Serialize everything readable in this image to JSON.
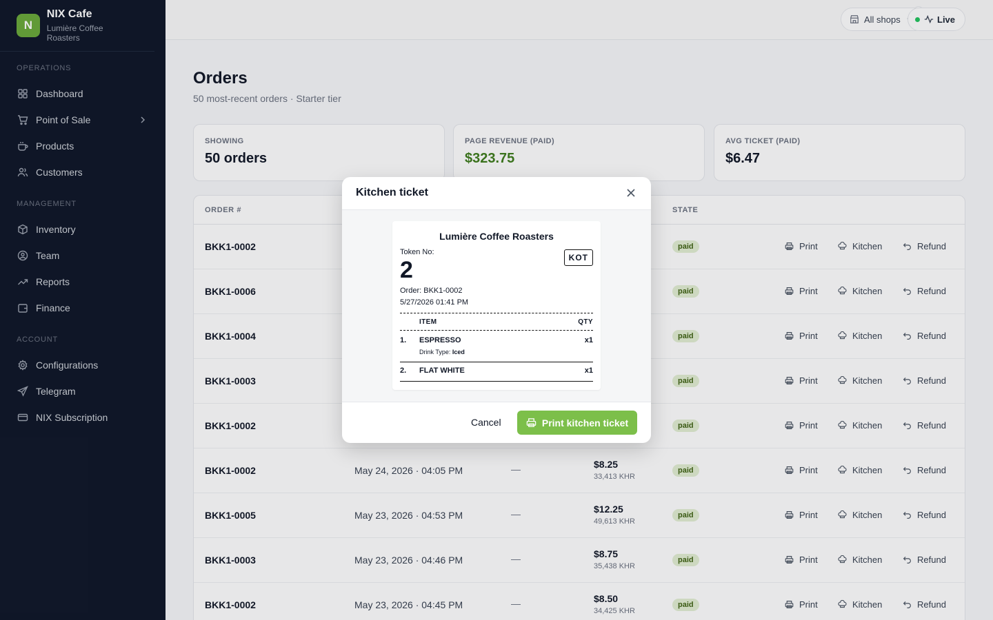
{
  "brand": {
    "initial": "N",
    "name": "NIX Cafe",
    "sub": "Lumière Coffee Roasters"
  },
  "sidebar": {
    "sections": [
      {
        "label": "OPERATIONS",
        "items": [
          {
            "label": "Dashboard",
            "icon": "grid-icon"
          },
          {
            "label": "Point of Sale",
            "icon": "cart-icon"
          },
          {
            "label": "Products",
            "icon": "cup-icon"
          },
          {
            "label": "Customers",
            "icon": "users-icon"
          }
        ]
      },
      {
        "label": "MANAGEMENT",
        "items": [
          {
            "label": "Inventory",
            "icon": "box-icon"
          },
          {
            "label": "Team",
            "icon": "user-circle-icon"
          },
          {
            "label": "Reports",
            "icon": "trend-icon"
          },
          {
            "label": "Finance",
            "icon": "wallet-icon"
          }
        ]
      },
      {
        "label": "ACCOUNT",
        "items": [
          {
            "label": "Configurations",
            "icon": "gear-icon"
          },
          {
            "label": "Telegram",
            "icon": "send-icon"
          },
          {
            "label": "NIX Subscription",
            "icon": "card-icon"
          }
        ]
      }
    ]
  },
  "topbar": {
    "shop": "All shops",
    "live": "Live"
  },
  "page": {
    "title": "Orders",
    "subtitle": "50 most-recent orders · Starter tier"
  },
  "stats": [
    {
      "label": "SHOWING",
      "value": "50 orders",
      "color": "#111827"
    },
    {
      "label": "PAGE REVENUE (PAID)",
      "value": "$323.75",
      "color": "#3f7d1d"
    },
    {
      "label": "AVG TICKET (PAID)",
      "value": "$6.47",
      "color": "#111827"
    }
  ],
  "table": {
    "headers": {
      "order": "ORDER #",
      "state": "STATE"
    },
    "actions": {
      "print": "Print",
      "kitchen": "Kitchen",
      "refund": "Refund"
    },
    "rows": [
      {
        "order": "BKK1-0002",
        "date": "",
        "dash": "",
        "total": "",
        "khr": "",
        "state": "paid"
      },
      {
        "order": "BKK1-0006",
        "date": "",
        "dash": "",
        "total": "",
        "khr": "",
        "state": "paid"
      },
      {
        "order": "BKK1-0004",
        "date": "",
        "dash": "",
        "total": "",
        "khr": "",
        "state": "paid"
      },
      {
        "order": "BKK1-0003",
        "date": "",
        "dash": "",
        "total": "",
        "khr": "",
        "state": "paid"
      },
      {
        "order": "BKK1-0002",
        "date": "",
        "dash": "",
        "total": "",
        "khr": "",
        "state": "paid"
      },
      {
        "order": "BKK1-0002",
        "date": "May 24, 2026 · 04:05 PM",
        "dash": "—",
        "total": "$8.25",
        "khr": "33,413 KHR",
        "state": "paid"
      },
      {
        "order": "BKK1-0005",
        "date": "May 23, 2026 · 04:53 PM",
        "dash": "—",
        "total": "$12.25",
        "khr": "49,613 KHR",
        "state": "paid"
      },
      {
        "order": "BKK1-0003",
        "date": "May 23, 2026 · 04:46 PM",
        "dash": "—",
        "total": "$8.75",
        "khr": "35,438 KHR",
        "state": "paid"
      },
      {
        "order": "BKK1-0002",
        "date": "May 23, 2026 · 04:45 PM",
        "dash": "—",
        "total": "$8.50",
        "khr": "34,425 KHR",
        "state": "paid"
      }
    ]
  },
  "modal": {
    "title": "Kitchen ticket",
    "cancel": "Cancel",
    "print": "Print kitchen ticket",
    "ticket": {
      "shop": "Lumière Coffee Roasters",
      "token_label": "Token No:",
      "token": "2",
      "badge": "KOT",
      "order": "Order: BKK1-0002",
      "time": "5/27/2026 01:41 PM",
      "col_item": "ITEM",
      "col_qty": "QTY",
      "items": [
        {
          "no": "1.",
          "name": "ESPRESSO",
          "qty": "x1",
          "mod_label": "Drink Type: ",
          "mod_value": "Iced"
        },
        {
          "no": "2.",
          "name": "FLAT WHITE",
          "qty": "x1"
        }
      ]
    }
  }
}
